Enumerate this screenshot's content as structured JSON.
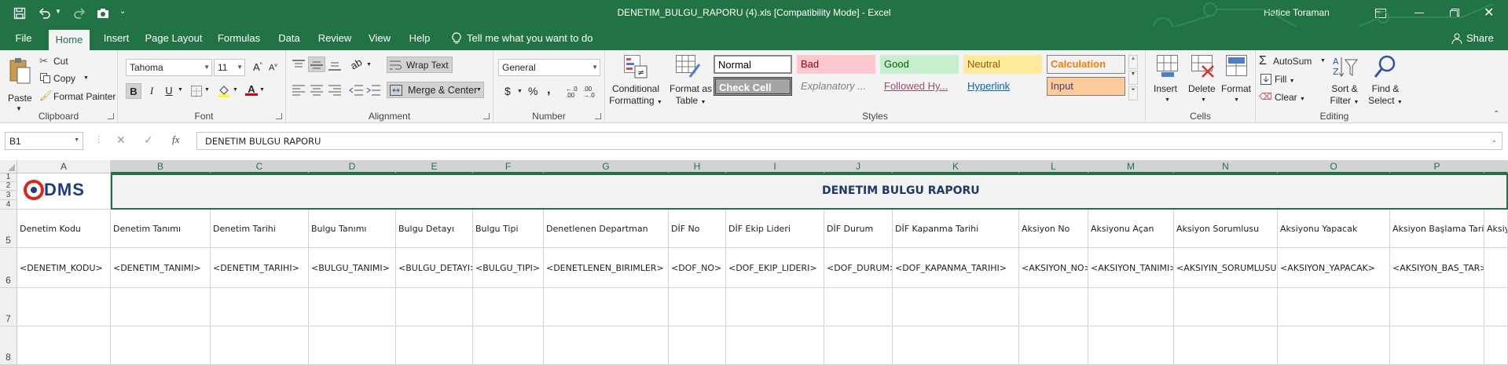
{
  "titlebar": {
    "title": "DENETIM_BULGU_RAPORU (4).xls  [Compatibility Mode]  -  Excel",
    "user": "Hatice Toraman"
  },
  "tabs": [
    "File",
    "Home",
    "Insert",
    "Page Layout",
    "Formulas",
    "Data",
    "Review",
    "View",
    "Help"
  ],
  "tell_me": "Tell me what you want to do",
  "share": "Share",
  "clipboard": {
    "paste": "Paste",
    "cut": "Cut",
    "copy": "Copy",
    "format_painter": "Format Painter",
    "label": "Clipboard"
  },
  "font": {
    "name": "Tahoma",
    "size": "11",
    "label": "Font",
    "bold": "B",
    "italic": "I",
    "underline": "U"
  },
  "alignment": {
    "wrap": "Wrap Text",
    "merge": "Merge & Center",
    "label": "Alignment"
  },
  "number": {
    "format": "General",
    "currency": "$",
    "percent": "%",
    "comma": ",",
    "inc": ".00 .0",
    "label": "Number"
  },
  "styles": {
    "conditional": "Conditional Formatting",
    "format_table": "Format as Table",
    "label": "Styles",
    "gallery": [
      {
        "name": "Normal",
        "fg": "#000000",
        "bg": "#ffffff"
      },
      {
        "name": "Bad",
        "fg": "#9c0006",
        "bg": "#ffc7ce"
      },
      {
        "name": "Good",
        "fg": "#006100",
        "bg": "#c6efce"
      },
      {
        "name": "Neutral",
        "fg": "#9c5700",
        "bg": "#ffeb9c"
      },
      {
        "name": "Calculation",
        "fg": "#fa7d00",
        "bg": "#f2f2f2"
      },
      {
        "name": "Check Cell",
        "fg": "#ffffff",
        "bg": "#a5a5a5"
      },
      {
        "name": "Explanatory ...",
        "fg": "#7f7f7f",
        "bg": "#ffffff"
      },
      {
        "name": "Followed Hy...",
        "fg": "#954f72",
        "bg": "#ffffff"
      },
      {
        "name": "Hyperlink",
        "fg": "#0563c1",
        "bg": "#ffffff"
      },
      {
        "name": "Input",
        "fg": "#3f3f76",
        "bg": "#ffcc99"
      }
    ]
  },
  "cells": {
    "insert": "Insert",
    "delete": "Delete",
    "format": "Format",
    "label": "Cells"
  },
  "editing": {
    "autosum": "AutoSum",
    "fill": "Fill",
    "clear": "Clear",
    "sort": "Sort & Filter",
    "find": "Find & Select",
    "label": "Editing"
  },
  "formula_bar": {
    "name_box": "B1",
    "fx": "fx",
    "content": "DENETIM BULGU RAPORU"
  },
  "columns": [
    "A",
    "B",
    "C",
    "D",
    "E",
    "F",
    "G",
    "H",
    "I",
    "J",
    "K",
    "L",
    "M",
    "N",
    "O",
    "P"
  ],
  "rows": [
    "1",
    "2",
    "3",
    "4",
    "5",
    "6",
    "7",
    "8"
  ],
  "logo": {
    "text": "DMS"
  },
  "report_title": "DENETIM BULGU RAPORU",
  "header_row": [
    "Denetim Kodu",
    "Denetim Tanımı",
    "Denetim Tarihi",
    "Bulgu Tanımı",
    "Bulgu Detayı",
    "Bulgu Tipi",
    "Denetlenen Departman",
    "DİF No",
    "DİF Ekip Lideri",
    "DİF Durum",
    "DİF Kapanma Tarihi",
    "Aksiyon No",
    "Aksiyonu Açan",
    "Aksiyon Sorumlusu",
    "Aksiyonu Yapacak",
    "Aksiyon Başlama Tarihi",
    "Aksiyo"
  ],
  "data_row": [
    "<DENETIM_KODU>",
    "<DENETIM_TANIMI>",
    "<DENETIM_TARIHI>",
    "<BULGU_TANIMI>",
    "<BULGU_DETAYI>",
    "<BULGU_TIPI>",
    "<DENETLENEN_BIRIMLER>",
    "<DOF_NO>",
    "<DOF_EKIP_LIDERI>",
    "<DOF_DURUM>",
    "<DOF_KAPANMA_TARIHI>",
    "<AKSIYON_NO>",
    "<AKSIYON_TANIMI>",
    "<AKSIYIN_SORUMLUSU>",
    "<AKSIYON_YAPACAK>",
    "<AKSIYON_BAS_TAR>",
    ""
  ],
  "colors": {
    "excel_green": "#217346",
    "title_blue": "#1f3864",
    "logo_red": "#e2231a",
    "logo_blue": "#1f3a8a"
  }
}
